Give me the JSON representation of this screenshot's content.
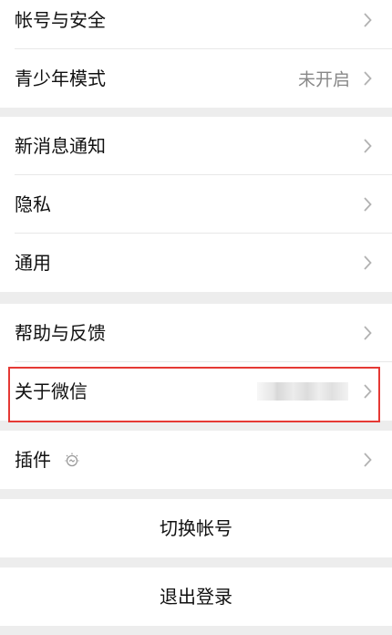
{
  "group1": {
    "account_security": "帐号与安全",
    "youth_mode": "青少年模式",
    "youth_mode_status": "未开启"
  },
  "group2": {
    "new_message_notice": "新消息通知",
    "privacy": "隐私",
    "general": "通用"
  },
  "group3": {
    "help_feedback": "帮助与反馈",
    "about_wechat": "关于微信"
  },
  "group4": {
    "plugins": "插件"
  },
  "actions": {
    "switch_account": "切换帐号",
    "log_out": "退出登录"
  },
  "icons": {
    "chevron": "chevron-right-icon",
    "plugin_badge": "plugin-bulb-icon"
  },
  "colors": {
    "background": "#ededed",
    "card": "#ffffff",
    "highlight": "#e53935",
    "secondary_text": "#888888"
  }
}
